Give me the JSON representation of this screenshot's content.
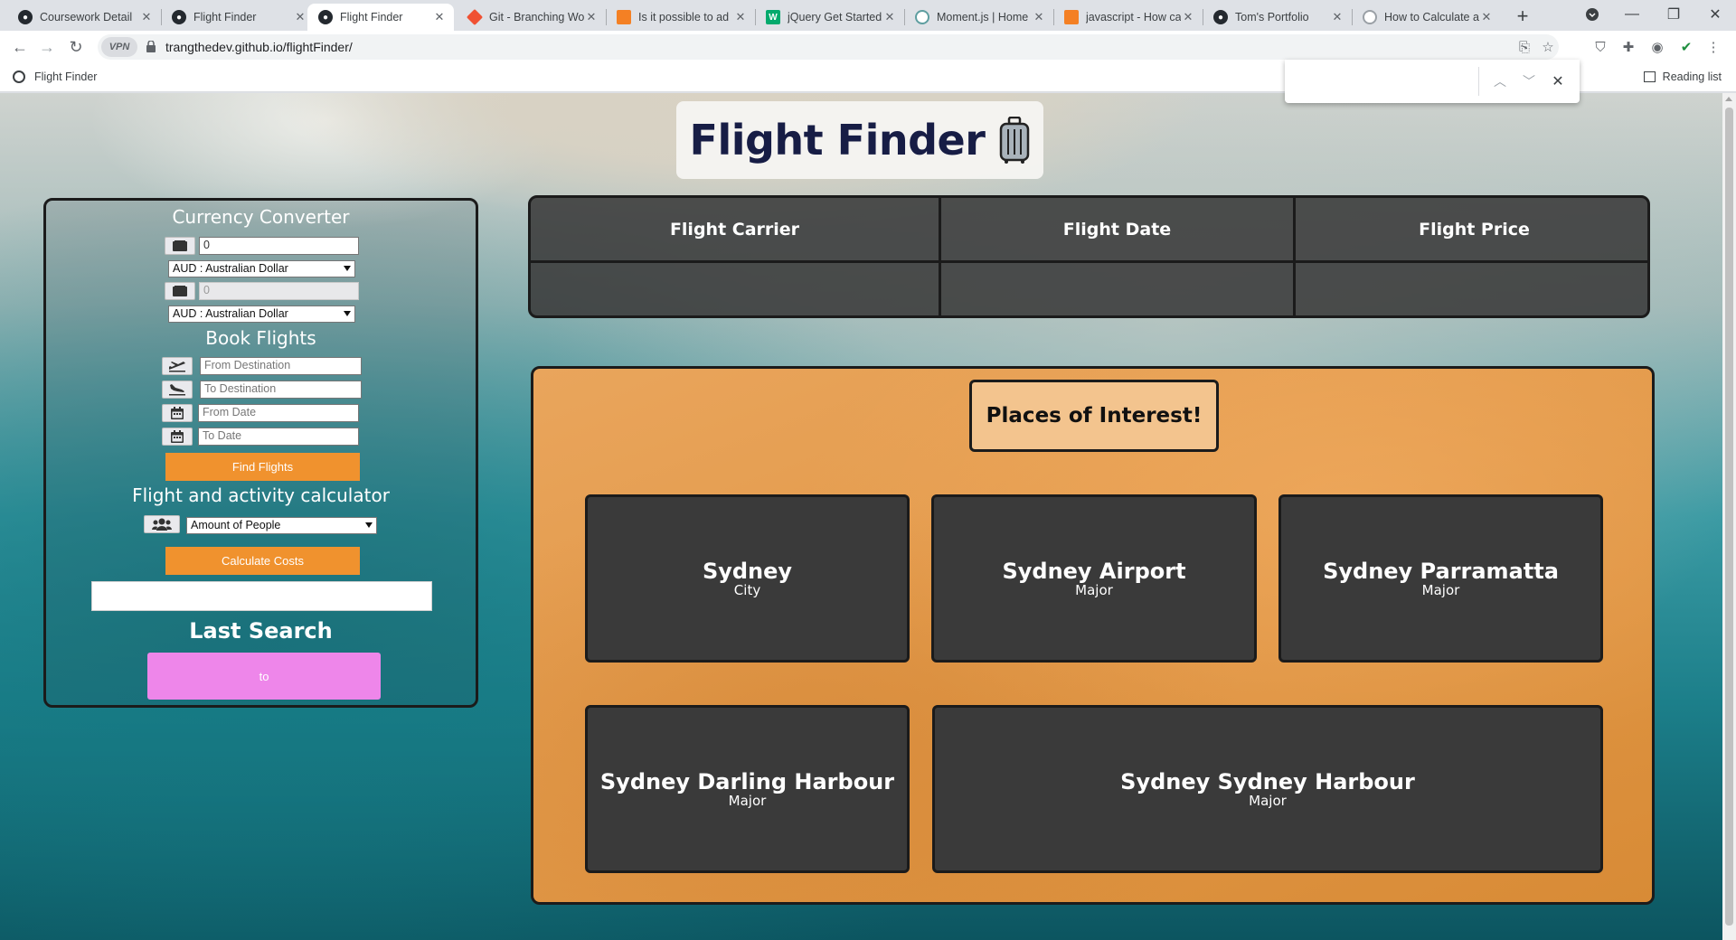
{
  "browser": {
    "tabs": [
      {
        "title": "Coursework Detail",
        "favicon": "github-icon",
        "color": "#24292f"
      },
      {
        "title": "Flight Finder",
        "favicon": "github-icon",
        "color": "#24292f"
      },
      {
        "title": "Flight Finder",
        "favicon": "github-icon",
        "color": "#24292f",
        "active": true
      },
      {
        "title": "Git - Branching Wo",
        "favicon": "git-icon",
        "color": "#f05133"
      },
      {
        "title": "Is it possible to ad",
        "favicon": "stackoverflow-icon",
        "color": "#f48024"
      },
      {
        "title": "jQuery Get Started",
        "favicon": "w3schools-icon",
        "color": "#04aa6d"
      },
      {
        "title": "Moment.js | Home",
        "favicon": "clock-icon",
        "color": "#5e9ea0"
      },
      {
        "title": "javascript - How ca",
        "favicon": "stackoverflow-icon",
        "color": "#f48024"
      },
      {
        "title": "Tom's Portfolio",
        "favicon": "github-icon",
        "color": "#24292f"
      },
      {
        "title": "How to Calculate a",
        "favicon": "dot-icon",
        "color": "#9aa0a6"
      }
    ],
    "url": "trangthedev.github.io/flightFinder/",
    "vpn_label": "VPN",
    "bookmark": "Flight Finder",
    "reading_list": "Reading list"
  },
  "page": {
    "title": "Flight Finder",
    "currency": {
      "heading": "Currency Converter",
      "amount_value": "0",
      "from_currency": "AUD : Australian Dollar",
      "result_value": "0",
      "to_currency": "AUD : Australian Dollar"
    },
    "book": {
      "heading": "Book Flights",
      "from_placeholder": "From Destination",
      "to_placeholder": "To Destination",
      "from_date_placeholder": "From Date",
      "to_date_placeholder": "To Date",
      "find_button": "Find Flights"
    },
    "calculator": {
      "heading": "Flight and activity calculator",
      "people_select": "Amount of People",
      "calculate_button": "Calculate Costs",
      "result": ""
    },
    "last_search": {
      "heading": "Last Search",
      "button": "to"
    },
    "flight_table": {
      "columns": [
        "Flight Carrier",
        "Flight Date",
        "Flight Price"
      ]
    },
    "places": {
      "heading": "Places of Interest!",
      "cards": [
        {
          "name": "Sydney",
          "type": "City"
        },
        {
          "name": "Sydney Airport",
          "type": "Major"
        },
        {
          "name": "Sydney Parramatta",
          "type": "Major"
        },
        {
          "name": "Sydney Darling Harbour",
          "type": "Major"
        },
        {
          "name": "Sydney Sydney Harbour",
          "type": "Major"
        }
      ]
    }
  },
  "colors": {
    "orange_button": "#f0922e",
    "pink_button": "#ee86ea",
    "card_bg": "#3a3a3a",
    "title_text": "#171d45"
  }
}
